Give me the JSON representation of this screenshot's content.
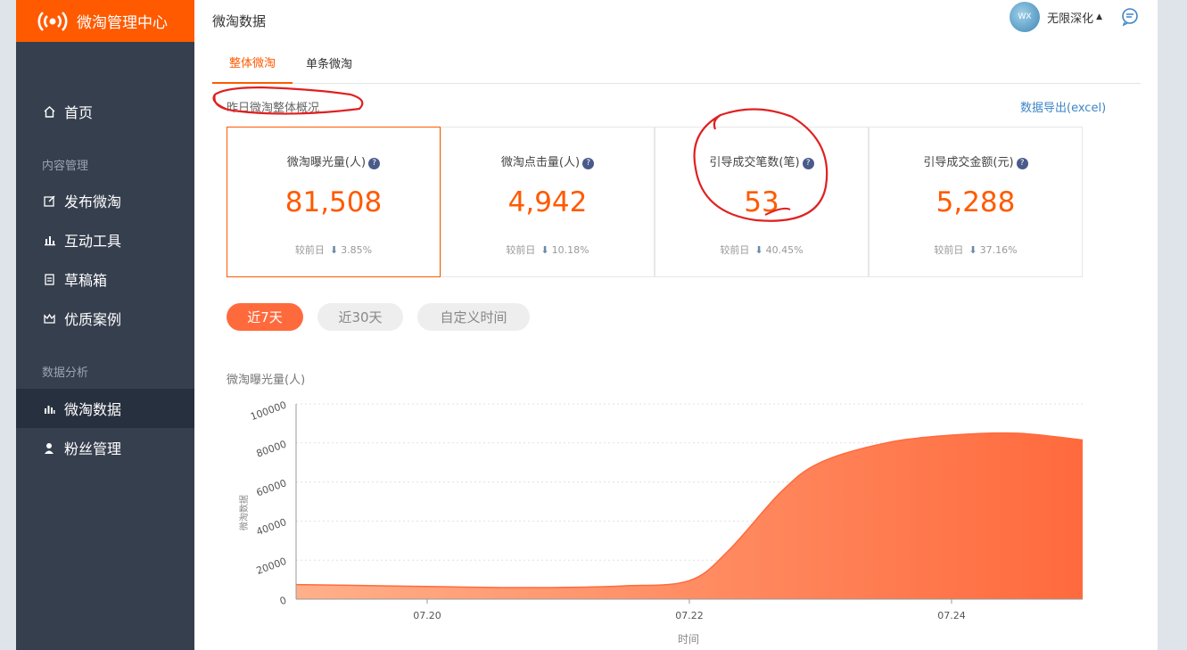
{
  "brand": {
    "title": "微淘管理中心",
    "color": "#ff5a00"
  },
  "sidebar": {
    "items": [
      {
        "id": "home",
        "label": "首页",
        "icon": "home-icon"
      },
      {
        "id": "publish",
        "label": "发布微淘",
        "icon": "edit-icon"
      },
      {
        "id": "tools",
        "label": "互动工具",
        "icon": "bar-chart-icon"
      },
      {
        "id": "drafts",
        "label": "草稿箱",
        "icon": "document-icon"
      },
      {
        "id": "cases",
        "label": "优质案例",
        "icon": "crown-icon"
      },
      {
        "id": "data",
        "label": "微淘数据",
        "icon": "chart-icon",
        "active": true
      },
      {
        "id": "fans",
        "label": "粉丝管理",
        "icon": "user-icon"
      }
    ],
    "groups": {
      "content": "内容管理",
      "analysis": "数据分析"
    }
  },
  "topbar": {
    "title": "微淘数据",
    "user": "无限深化",
    "avatar_text": "WX"
  },
  "tabs": [
    {
      "label": "整体微淘",
      "active": true
    },
    {
      "label": "单条微淘",
      "active": false
    }
  ],
  "overview": {
    "title": "昨日微淘整体概况",
    "export": "数据导出(excel)",
    "compare_label": "较前日",
    "cards": [
      {
        "label": "微淘曝光量(人)",
        "value": "81,508",
        "change": "3.85%"
      },
      {
        "label": "微淘点击量(人)",
        "value": "4,942",
        "change": "10.18%"
      },
      {
        "label": "引导成交笔数(笔)",
        "value": "53",
        "change": "40.45%"
      },
      {
        "label": "引导成交金额(元)",
        "value": "5,288",
        "change": "37.16%"
      }
    ]
  },
  "range": [
    {
      "label": "近7天",
      "active": true
    },
    {
      "label": "近30天",
      "active": false
    },
    {
      "label": "自定义时间",
      "active": false
    }
  ],
  "chart_data": {
    "type": "area",
    "title": "微淘曝光量(人)",
    "xlabel": "时间",
    "ylabel": "微淘数据",
    "ylim": [
      0,
      100000
    ],
    "yticks": [
      "100000",
      "80000",
      "60000",
      "40000",
      "20000",
      "0"
    ],
    "xticks": [
      "07.20",
      "07.22",
      "07.24"
    ],
    "x": [
      0,
      0.5,
      1,
      1.5,
      2,
      2.5,
      3,
      3.3,
      3.7,
      4,
      4.5,
      5,
      5.5,
      6
    ],
    "values": [
      7500,
      7000,
      6500,
      6000,
      6000,
      6800,
      9500,
      25000,
      55000,
      70000,
      80000,
      84000,
      85000,
      81500
    ],
    "color": "#ff6a3d"
  }
}
